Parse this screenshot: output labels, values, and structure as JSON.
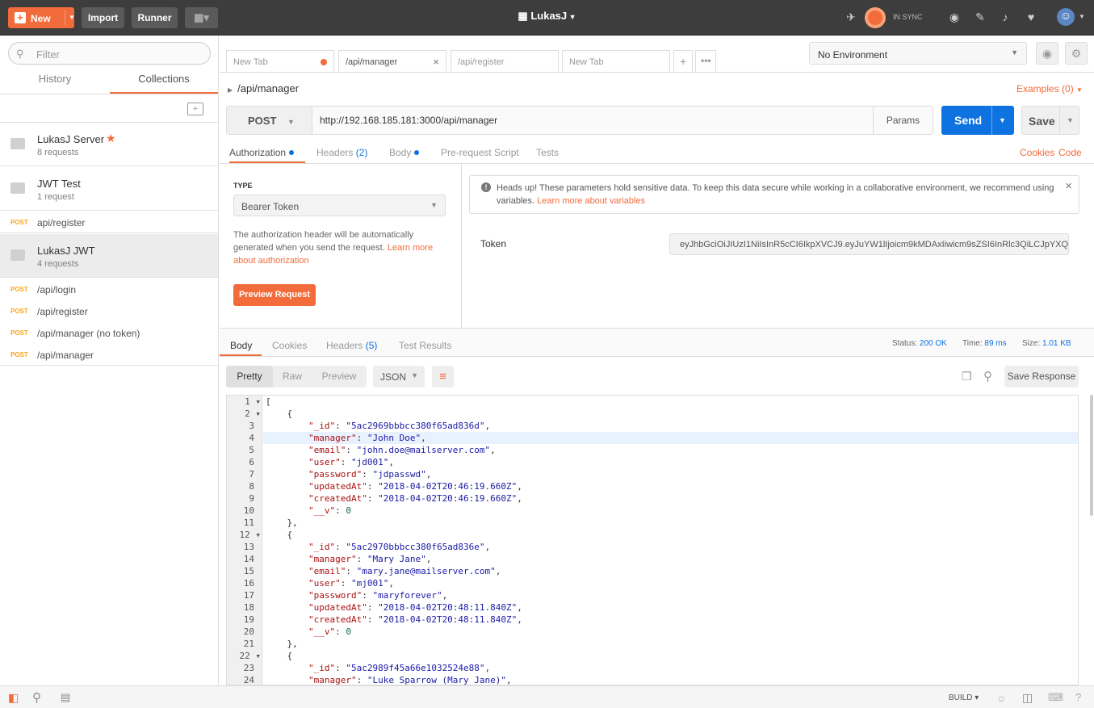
{
  "topbar": {
    "new_label": "New",
    "import_label": "Import",
    "runner_label": "Runner",
    "workspace": "LukasJ",
    "sync_status": "IN SYNC"
  },
  "sidebar": {
    "filter_placeholder": "Filter",
    "tabs": [
      "History",
      "Collections"
    ],
    "collections": [
      {
        "name": "LukasJ Server",
        "count": "8 requests"
      },
      {
        "name": "JWT Test",
        "count": "1 request"
      }
    ],
    "loose_requests": [
      {
        "method": "POST",
        "path": "api/register"
      }
    ],
    "jwt_collection": {
      "name": "LukasJ JWT",
      "count": "4 requests"
    },
    "jwt_requests": [
      {
        "method": "POST",
        "path": "/api/login"
      },
      {
        "method": "POST",
        "path": "/api/register"
      },
      {
        "method": "POST",
        "path": "/api/manager (no token)"
      },
      {
        "method": "POST",
        "path": "/api/manager"
      }
    ]
  },
  "tabs": [
    {
      "label": "New Tab"
    },
    {
      "label": "/api/manager"
    },
    {
      "label": "/api/register"
    },
    {
      "label": "New Tab"
    }
  ],
  "environment": "No Environment",
  "request": {
    "breadcrumb": "/api/manager",
    "examples": "Examples (0)",
    "method": "POST",
    "url": "http://192.168.185.181:3000/api/manager",
    "params_label": "Params",
    "send_label": "Send",
    "save_label": "Save",
    "subtabs": {
      "authorization": "Authorization",
      "headers": "Headers",
      "headers_count": "(2)",
      "body": "Body",
      "prerequest": "Pre-request Script",
      "tests": "Tests"
    },
    "cookies_link": "Cookies",
    "code_link": "Code"
  },
  "auth": {
    "type_label": "TYPE",
    "type_value": "Bearer Token",
    "description": "The authorization header will be automatically generated when you send the request.",
    "learn_link_1": "Learn more",
    "learn_link_2": "about authorization",
    "preview_button": "Preview Request",
    "note_text": "Heads up! These parameters hold sensitive data. To keep this data secure while working in a collaborative environment, we recommend",
    "note_text_2": "using variables.",
    "note_link": "Learn more about variables",
    "token_label": "Token",
    "token_value": "eyJhbGciOiJIUzI1NiIsInR5cCI6IkpXVCJ9.eyJuYW1lIjoicm9kMDAxIiwicm9sZSI6InRlc3QiLCJpYXQi..."
  },
  "response": {
    "tabs": {
      "body": "Body",
      "cookies": "Cookies",
      "headers": "Headers",
      "headers_count": "(5)",
      "tests": "Test Results"
    },
    "status_label": "Status:",
    "status_value": "200 OK",
    "time_label": "Time:",
    "time_value": "89 ms",
    "size_label": "Size:",
    "size_value": "1.01 KB",
    "view_modes": [
      "Pretty",
      "Raw",
      "Preview"
    ],
    "format": "JSON",
    "save_response": "Save Response"
  },
  "body_lines": [
    {
      "n": "1",
      "f": true,
      "t": "["
    },
    {
      "n": "2",
      "f": true,
      "t": "    {"
    },
    {
      "n": "3",
      "k": "\"_id\"",
      "v": "\"5ac2969bbbcc380f65ad836d\"",
      "s": true
    },
    {
      "n": "4",
      "k": "\"manager\"",
      "v": "\"John Doe\"",
      "s": true
    },
    {
      "n": "5",
      "k": "\"email\"",
      "v": "\"john.doe@mailserver.com\"",
      "s": true
    },
    {
      "n": "6",
      "k": "\"user\"",
      "v": "\"jd001\"",
      "s": true
    },
    {
      "n": "7",
      "k": "\"password\"",
      "v": "\"jdpasswd\"",
      "s": true
    },
    {
      "n": "8",
      "k": "\"updatedAt\"",
      "v": "\"2018-04-02T20:46:19.660Z\"",
      "s": true
    },
    {
      "n": "9",
      "k": "\"createdAt\"",
      "v": "\"2018-04-02T20:46:19.660Z\"",
      "s": true
    },
    {
      "n": "10",
      "k": "\"__v\"",
      "v": "0",
      "s": false
    },
    {
      "n": "11",
      "t": "    },"
    },
    {
      "n": "12",
      "f": true,
      "t": "    {"
    },
    {
      "n": "13",
      "k": "\"_id\"",
      "v": "\"5ac2970bbbcc380f65ad836e\"",
      "s": true
    },
    {
      "n": "14",
      "k": "\"manager\"",
      "v": "\"Mary Jane\"",
      "s": true
    },
    {
      "n": "15",
      "k": "\"email\"",
      "v": "\"mary.jane@mailserver.com\"",
      "s": true
    },
    {
      "n": "16",
      "k": "\"user\"",
      "v": "\"mj001\"",
      "s": true
    },
    {
      "n": "17",
      "k": "\"password\"",
      "v": "\"maryforever\"",
      "s": true
    },
    {
      "n": "18",
      "k": "\"updatedAt\"",
      "v": "\"2018-04-02T20:48:11.840Z\"",
      "s": true
    },
    {
      "n": "19",
      "k": "\"createdAt\"",
      "v": "\"2018-04-02T20:48:11.840Z\"",
      "s": true
    },
    {
      "n": "20",
      "k": "\"__v\"",
      "v": "0",
      "s": false
    },
    {
      "n": "21",
      "t": "    },"
    },
    {
      "n": "22",
      "f": true,
      "t": "    {"
    },
    {
      "n": "23",
      "k": "\"_id\"",
      "v": "\"5ac2989f45a66e1032524e88\"",
      "s": true
    },
    {
      "n": "24",
      "k": "\"manager\"",
      "v": "\"Luke Sparrow (Mary Jane)\"",
      "s": true
    }
  ],
  "footer": {
    "build_label": "BUILD ▾"
  },
  "colors": {
    "accent": "#f26b3a",
    "send": "#0e73e0",
    "topbar": "#3d3d3d"
  }
}
